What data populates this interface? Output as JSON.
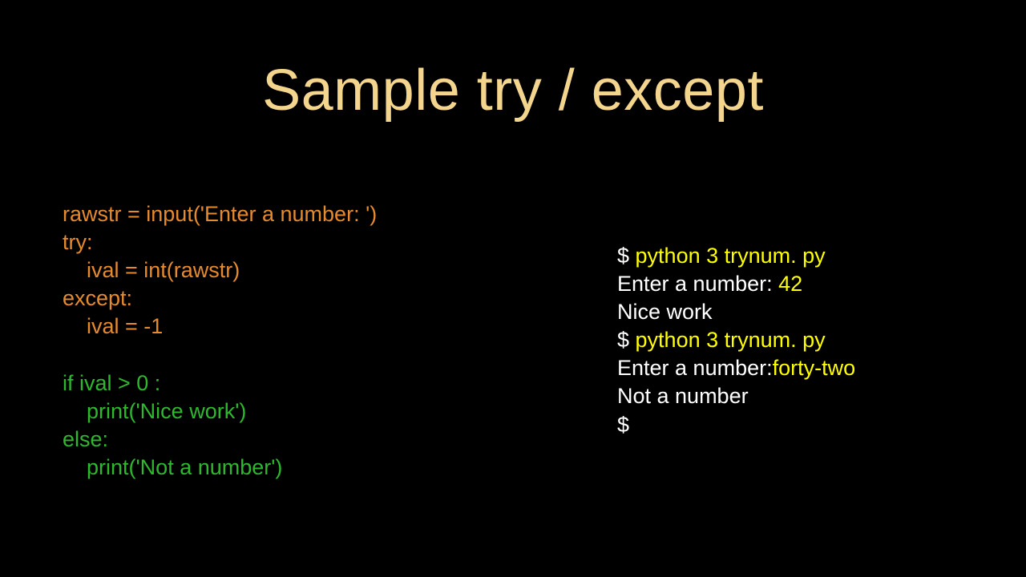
{
  "title": "Sample try / except",
  "code": {
    "l1": "rawstr = input('Enter a number: ')",
    "l2": "try:",
    "l3": "    ival = int(rawstr)",
    "l4": "except:",
    "l5": "    ival = -1",
    "l6": "",
    "l7": "if ival > 0 :",
    "l8": "    print('Nice work')",
    "l9": "else:",
    "l10": "    print('Not a number')"
  },
  "output": {
    "r1a": "$ ",
    "r1b": "python 3 trynum. py",
    "r2a": "Enter a number: ",
    "r2b": "42",
    "r3": "Nice work",
    "r4a": "$ ",
    "r4b": "python 3 trynum. py",
    "r5a": "Enter a number:",
    "r5b": "forty-two",
    "r6": "Not a number",
    "r7": "$"
  }
}
